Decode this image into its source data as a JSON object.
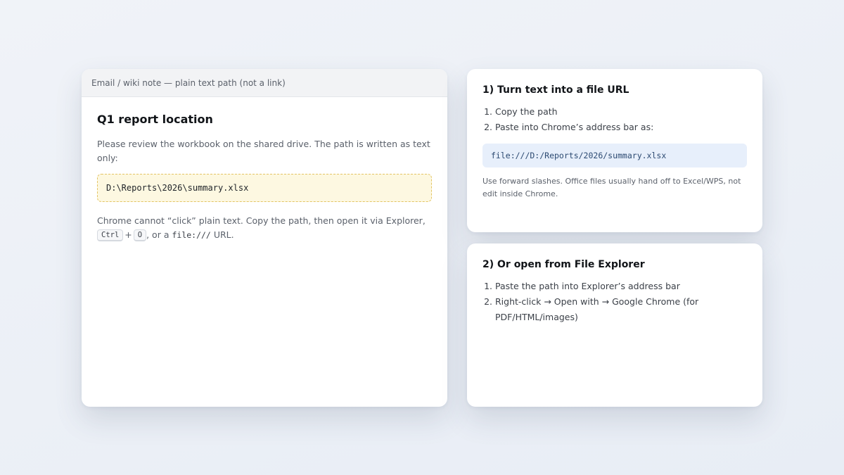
{
  "email_note": {
    "header": "Email / wiki note — plain text path (not a link)",
    "title": "Q1 report location",
    "intro": "Please review the workbook on the shared drive. The path is written as text only:",
    "path": "D:\\Reports\\2026\\summary.xlsx",
    "help_before": "Chrome cannot “click” plain text. Copy the path, then open it via Explorer,",
    "key_ctrl": "Ctrl",
    "key_plus": "+",
    "key_o": "O",
    "help_mid": ", or a",
    "help_scheme": "file:///",
    "help_after": "URL."
  },
  "file_url_card": {
    "title": "1) Turn text into a file URL",
    "steps": [
      "Copy the path",
      "Paste into Chrome’s address bar as:"
    ],
    "url": "file:///D:/Reports/2026/summary.xlsx",
    "note": "Use forward slashes. Office files usually hand off to Excel/WPS, not edit inside Chrome."
  },
  "explorer_card": {
    "title": "2) Or open from File Explorer",
    "steps": [
      "Paste the path into Explorer’s address bar",
      "Right-click → Open with → Google Chrome (for PDF/HTML/images)"
    ]
  }
}
